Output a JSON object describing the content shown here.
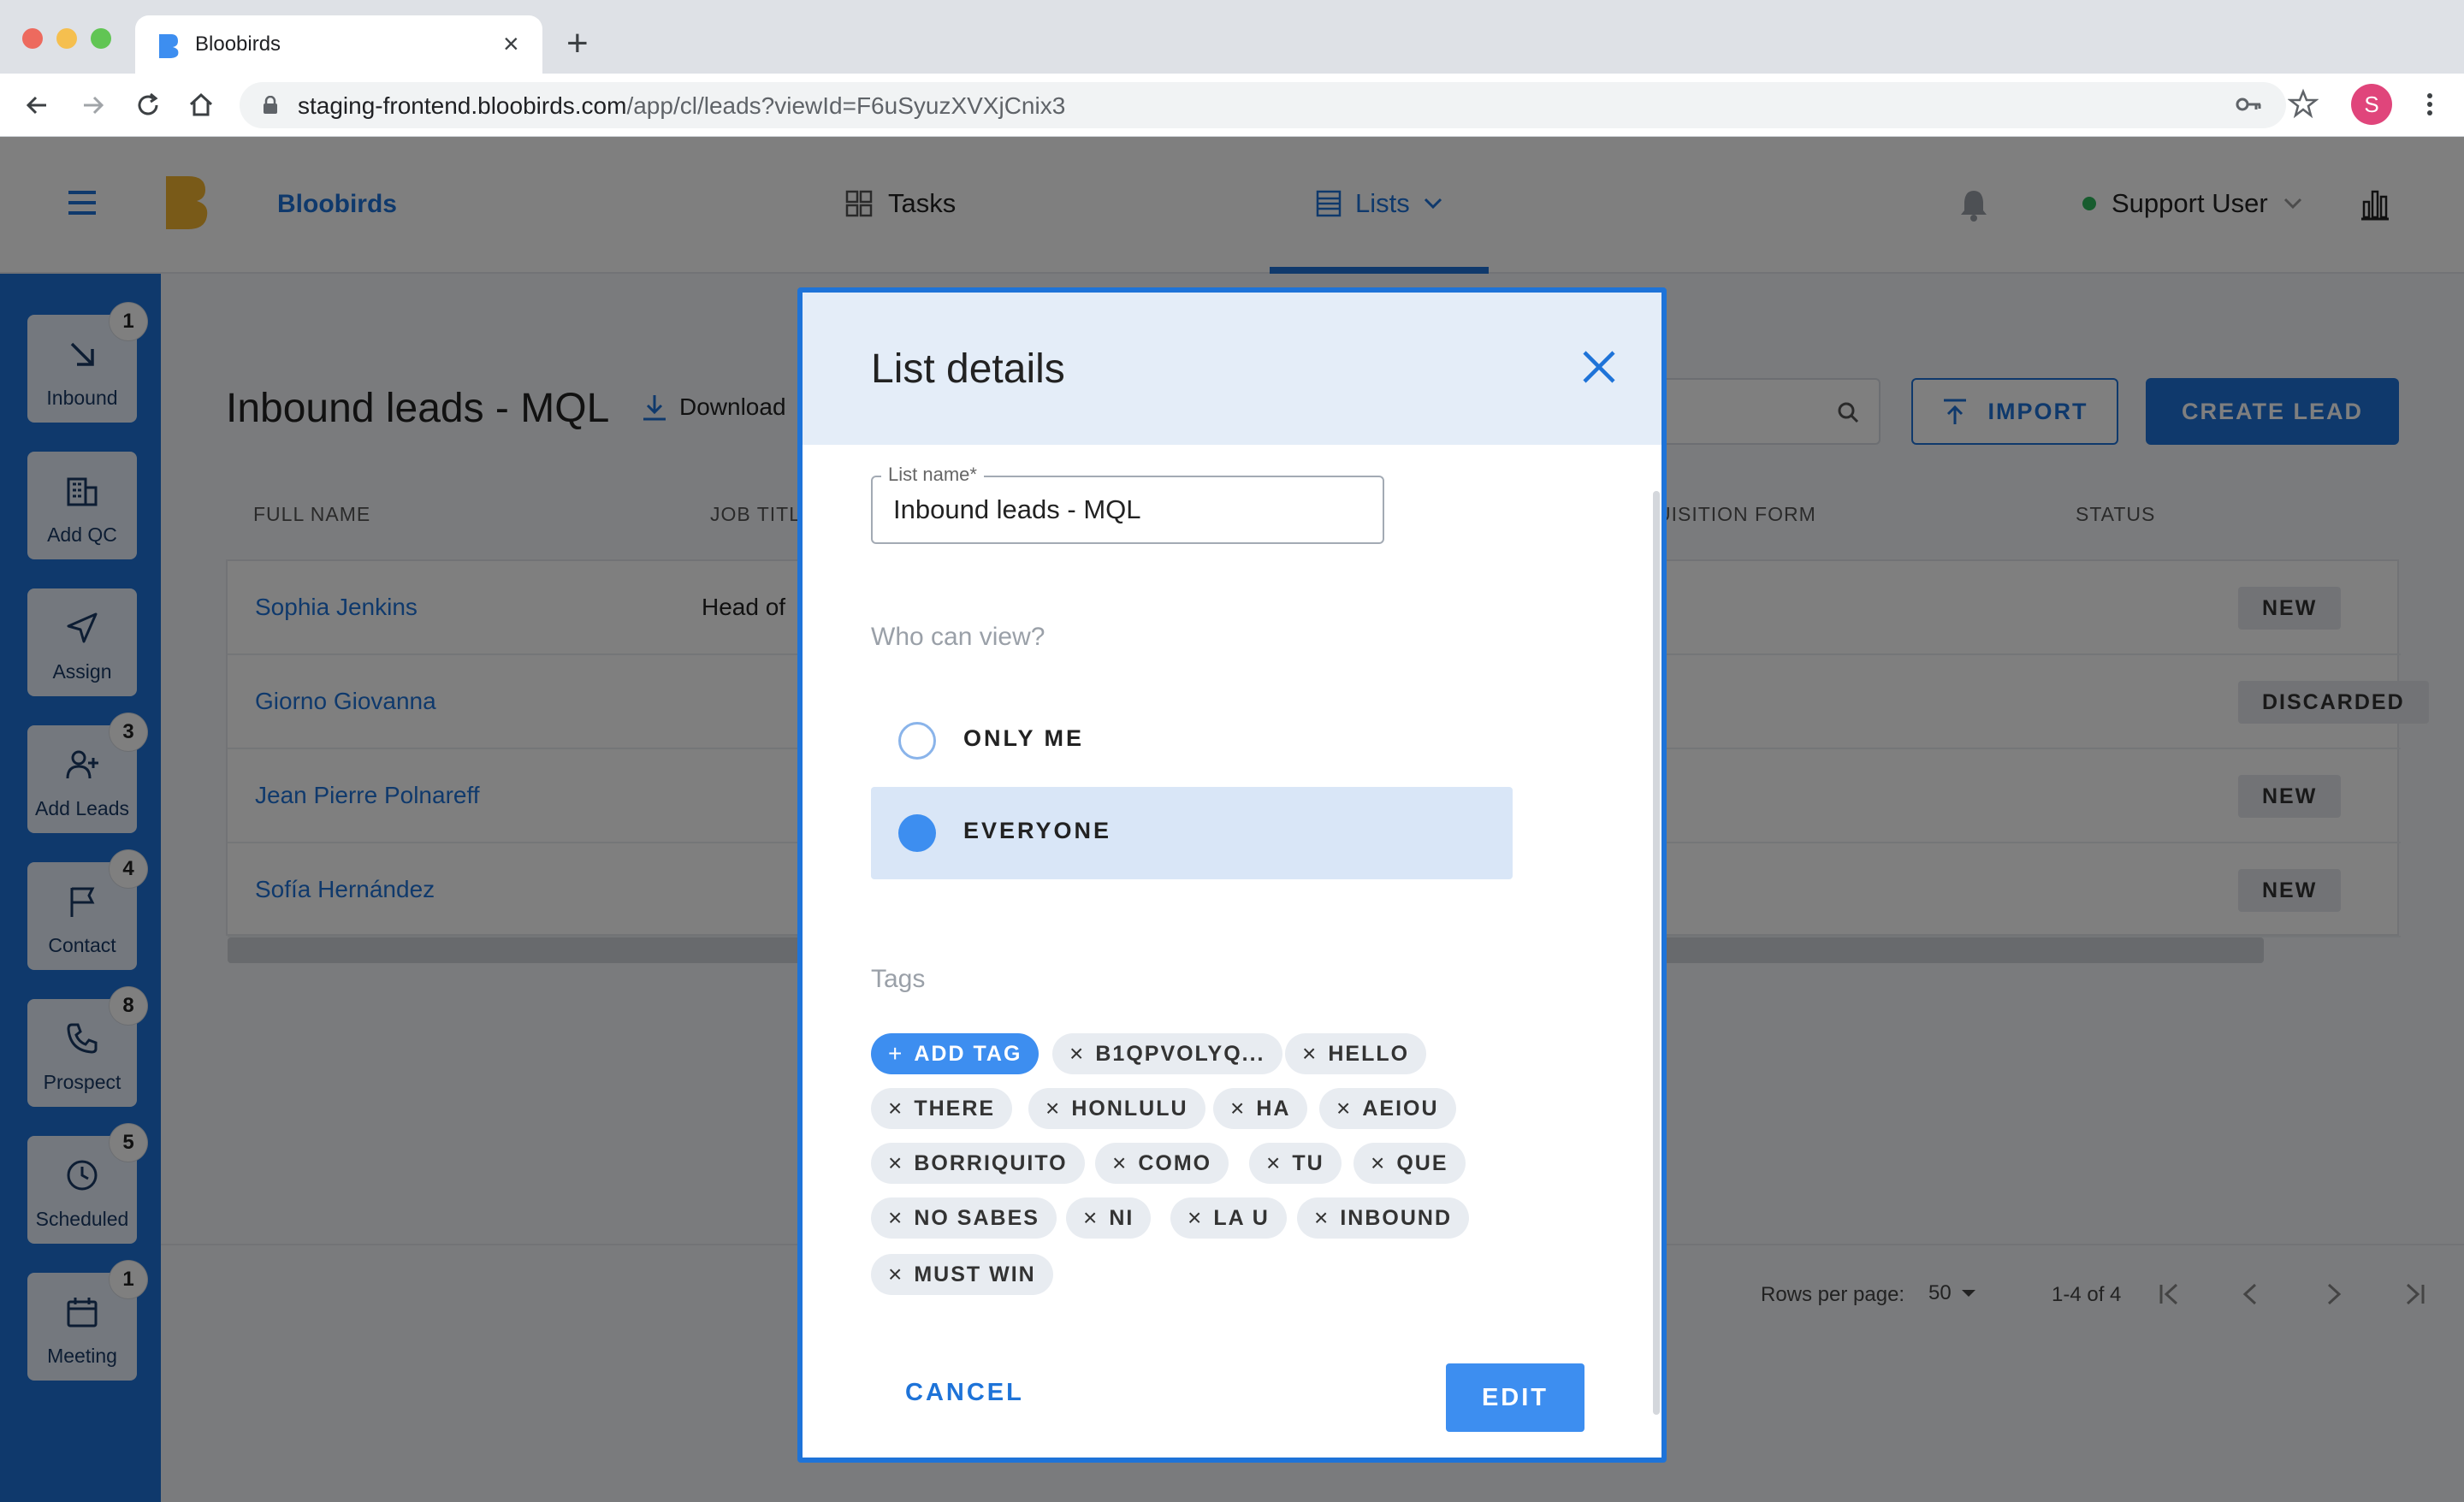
{
  "browser": {
    "tab_title": "Bloobirds",
    "url_host": "staging-frontend.bloobirds.com",
    "url_path": "/app/cl/leads?viewId=F6uSyuzXVXjCnix3",
    "profile_initial": "S"
  },
  "app": {
    "brand": "Bloobirds",
    "nav_tasks": "Tasks",
    "nav_lists": "Lists",
    "user_name": "Support User"
  },
  "sidebar": {
    "items": [
      {
        "label": "Inbound",
        "badge": "1",
        "icon": "arrow-down-right-icon"
      },
      {
        "label": "Add QC",
        "badge": "",
        "icon": "building-icon"
      },
      {
        "label": "Assign",
        "badge": "",
        "icon": "send-icon"
      },
      {
        "label": "Add Leads",
        "badge": "3",
        "icon": "user-plus-icon"
      },
      {
        "label": "Contact",
        "badge": "4",
        "icon": "flag-icon"
      },
      {
        "label": "Prospect",
        "badge": "8",
        "icon": "phone-icon"
      },
      {
        "label": "Scheduled",
        "badge": "5",
        "icon": "clock-icon"
      },
      {
        "label": "Meeting",
        "badge": "1",
        "icon": "calendar-icon"
      }
    ]
  },
  "page": {
    "title": "Inbound leads - MQL",
    "download_label": "Download",
    "import_label": "IMPORT",
    "create_label": "CREATE LEAD"
  },
  "table": {
    "headers": [
      "FULL NAME",
      "JOB TITLE",
      "UISITION FORM",
      "STATUS"
    ],
    "rows": [
      {
        "name": "Sophia Jenkins",
        "job": "Head of",
        "status": "NEW"
      },
      {
        "name": "Giorno Giovanna",
        "job": "",
        "status": "DISCARDED"
      },
      {
        "name": "Jean Pierre Polnareff",
        "job": "",
        "status": "NEW"
      },
      {
        "name": "Sofía Hernández",
        "job": "",
        "status": "NEW"
      }
    ]
  },
  "pagination": {
    "rows_per_page_label": "Rows per page:",
    "rows_per_page": "50",
    "range": "1-4 of 4"
  },
  "modal": {
    "title": "List details",
    "list_name_label": "List name*",
    "list_name_value": "Inbound leads - MQL",
    "who_can_view": "Who can view?",
    "option_only_me": "ONLY ME",
    "option_everyone": "EVERYONE",
    "selected_option": "EVERYONE",
    "tags_title": "Tags",
    "add_tag_label": "ADD TAG",
    "tags": [
      "B1QPVOLYQ...",
      "HELLO",
      "THERE",
      "HONLULU",
      "HA",
      "AEIOU",
      "BORRIQUITO",
      "COMO",
      "TU",
      "QUE",
      "NO SABES",
      "NI",
      "LA U",
      "INBOUND",
      "MUST WIN"
    ],
    "cancel_label": "CANCEL",
    "edit_label": "EDIT"
  },
  "colors": {
    "primary": "#1e73d8",
    "accent": "#3d8ef0",
    "modal_header": "#e4edf8"
  }
}
